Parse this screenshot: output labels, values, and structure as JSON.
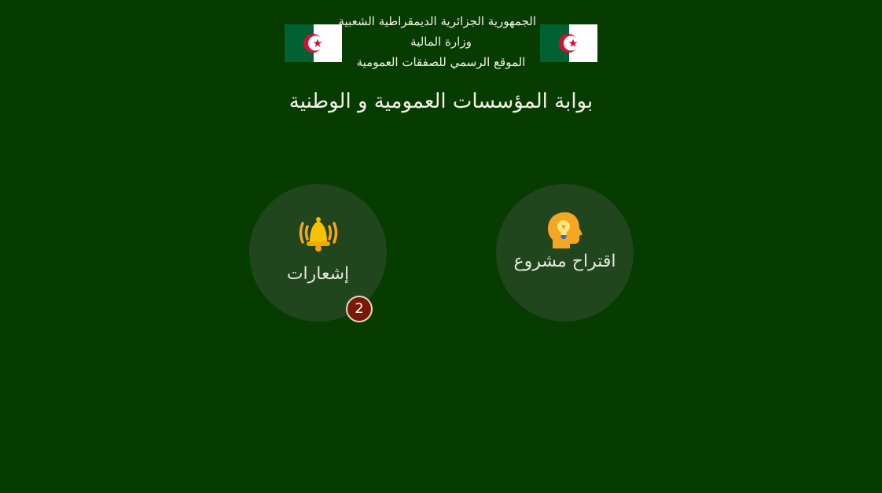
{
  "header": {
    "line1": "الجمهورية الجزائرية الديمقراطية الشعبية",
    "line2": "وزارة المالية",
    "line3": "الموقع الرسمي للصفقات العمومية"
  },
  "portal_title": "بوابة المؤسسات العمومية و الوطنية",
  "tiles": {
    "propose_project": {
      "label": "اقتراح مشروع",
      "icon": "lightbulb-head-icon"
    },
    "notifications": {
      "label": "إشعارات",
      "icon": "ringing-bell-icon",
      "badge_count": "2"
    }
  },
  "colors": {
    "background": "#073c00",
    "tile": "#21451d",
    "badge": "#7a1a06",
    "flag_green": "#006233",
    "flag_red": "#d21034"
  }
}
